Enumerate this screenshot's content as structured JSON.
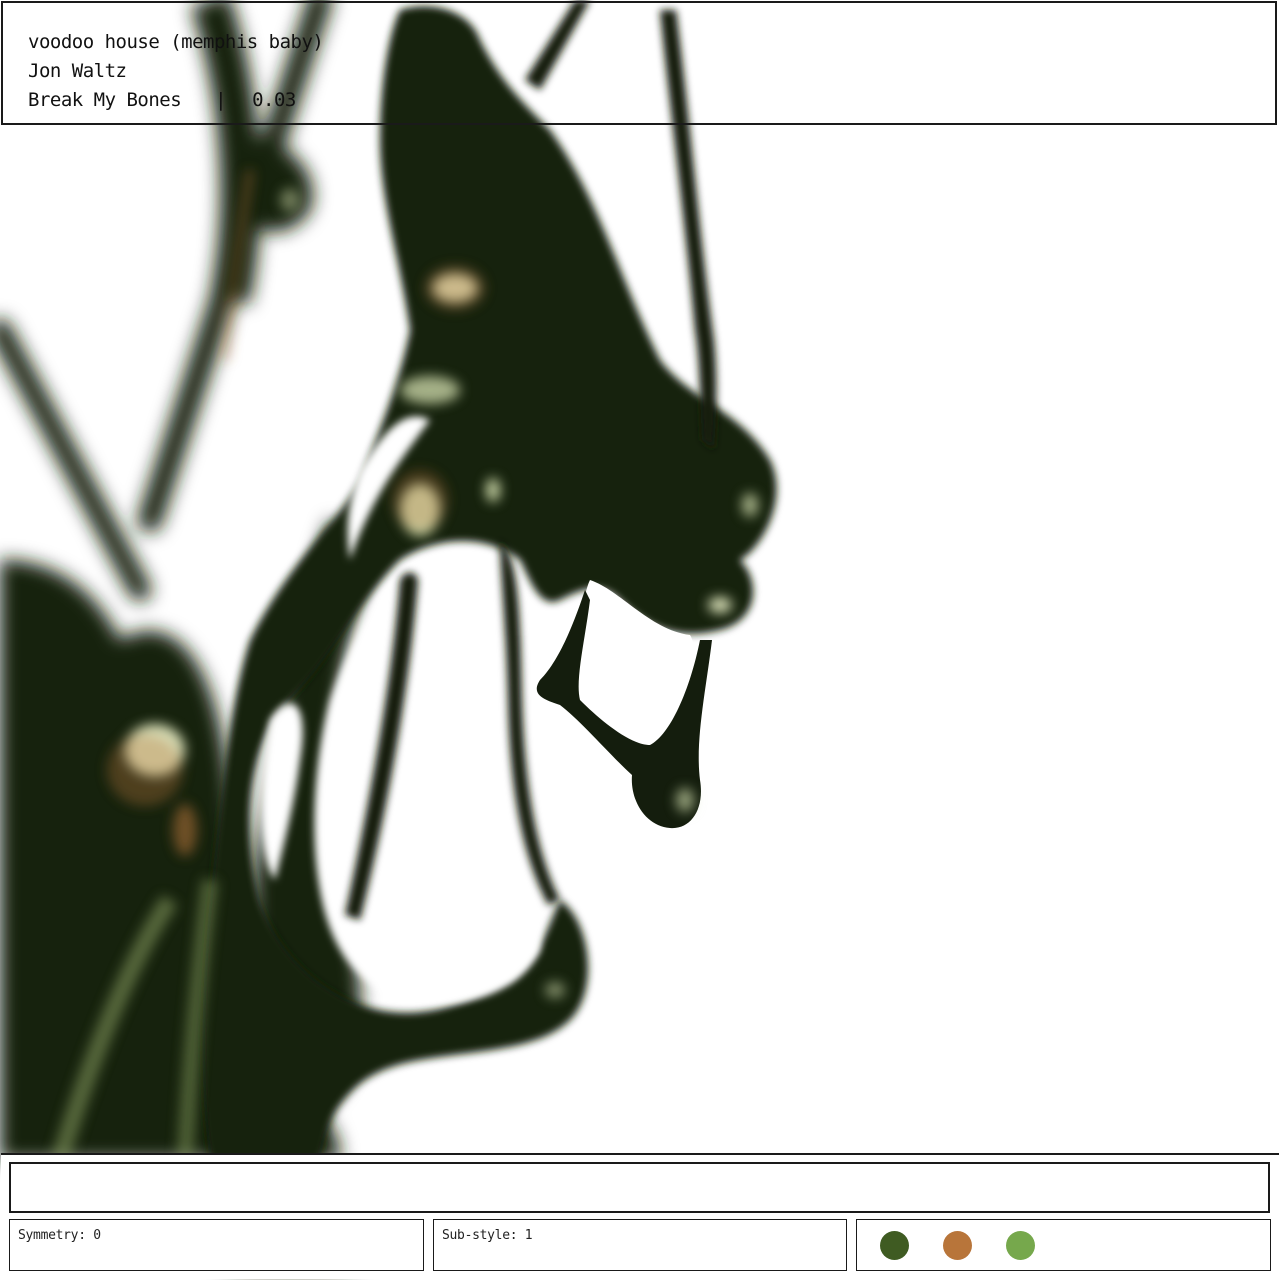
{
  "now_playing": {
    "title": "voodoo house (memphis baby)",
    "artist": "Jon Waltz",
    "album": "Break My Bones",
    "separator": "|",
    "value": "0.03"
  },
  "controls": {
    "input_value": "",
    "symmetry_label": "Symmetry: 0",
    "substyle_label": "Sub-style: 1"
  },
  "palette": {
    "colors": [
      "#3f5b22",
      "#b8753a",
      "#76a84c"
    ],
    "names": [
      "dark-green-swatch",
      "orange-swatch",
      "light-green-swatch"
    ]
  },
  "art": {
    "blob_color": "#16200f",
    "highlight_color": "#c9d5a6",
    "warm_accent": "#b8753a",
    "background": "#ffffff"
  }
}
